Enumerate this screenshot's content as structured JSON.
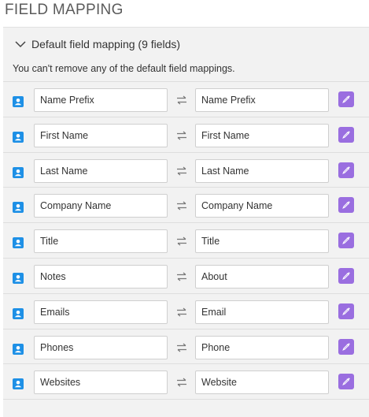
{
  "page": {
    "title": "FIELD MAPPING"
  },
  "section": {
    "title": "Default field mapping (9 fields)",
    "note": "You can't remove any of the default field mappings."
  },
  "colors": {
    "accent_edit": "#9a6ee0",
    "contact_icon": "#1e90e6",
    "panel_bg": "#f2f2f2"
  },
  "icons": {
    "row_icon": "contact-card-icon",
    "swap": "swap-arrows-icon",
    "edit": "eyedropper-icon",
    "toggle": "chevron-down-icon"
  },
  "mappings": [
    {
      "source": "Name Prefix",
      "target": "Name Prefix"
    },
    {
      "source": "First Name",
      "target": "First Name"
    },
    {
      "source": "Last Name",
      "target": "Last Name"
    },
    {
      "source": "Company Name",
      "target": "Company Name"
    },
    {
      "source": "Title",
      "target": "Title"
    },
    {
      "source": "Notes",
      "target": "About"
    },
    {
      "source": "Emails",
      "target": "Email"
    },
    {
      "source": "Phones",
      "target": "Phone"
    },
    {
      "source": "Websites",
      "target": "Website"
    }
  ]
}
